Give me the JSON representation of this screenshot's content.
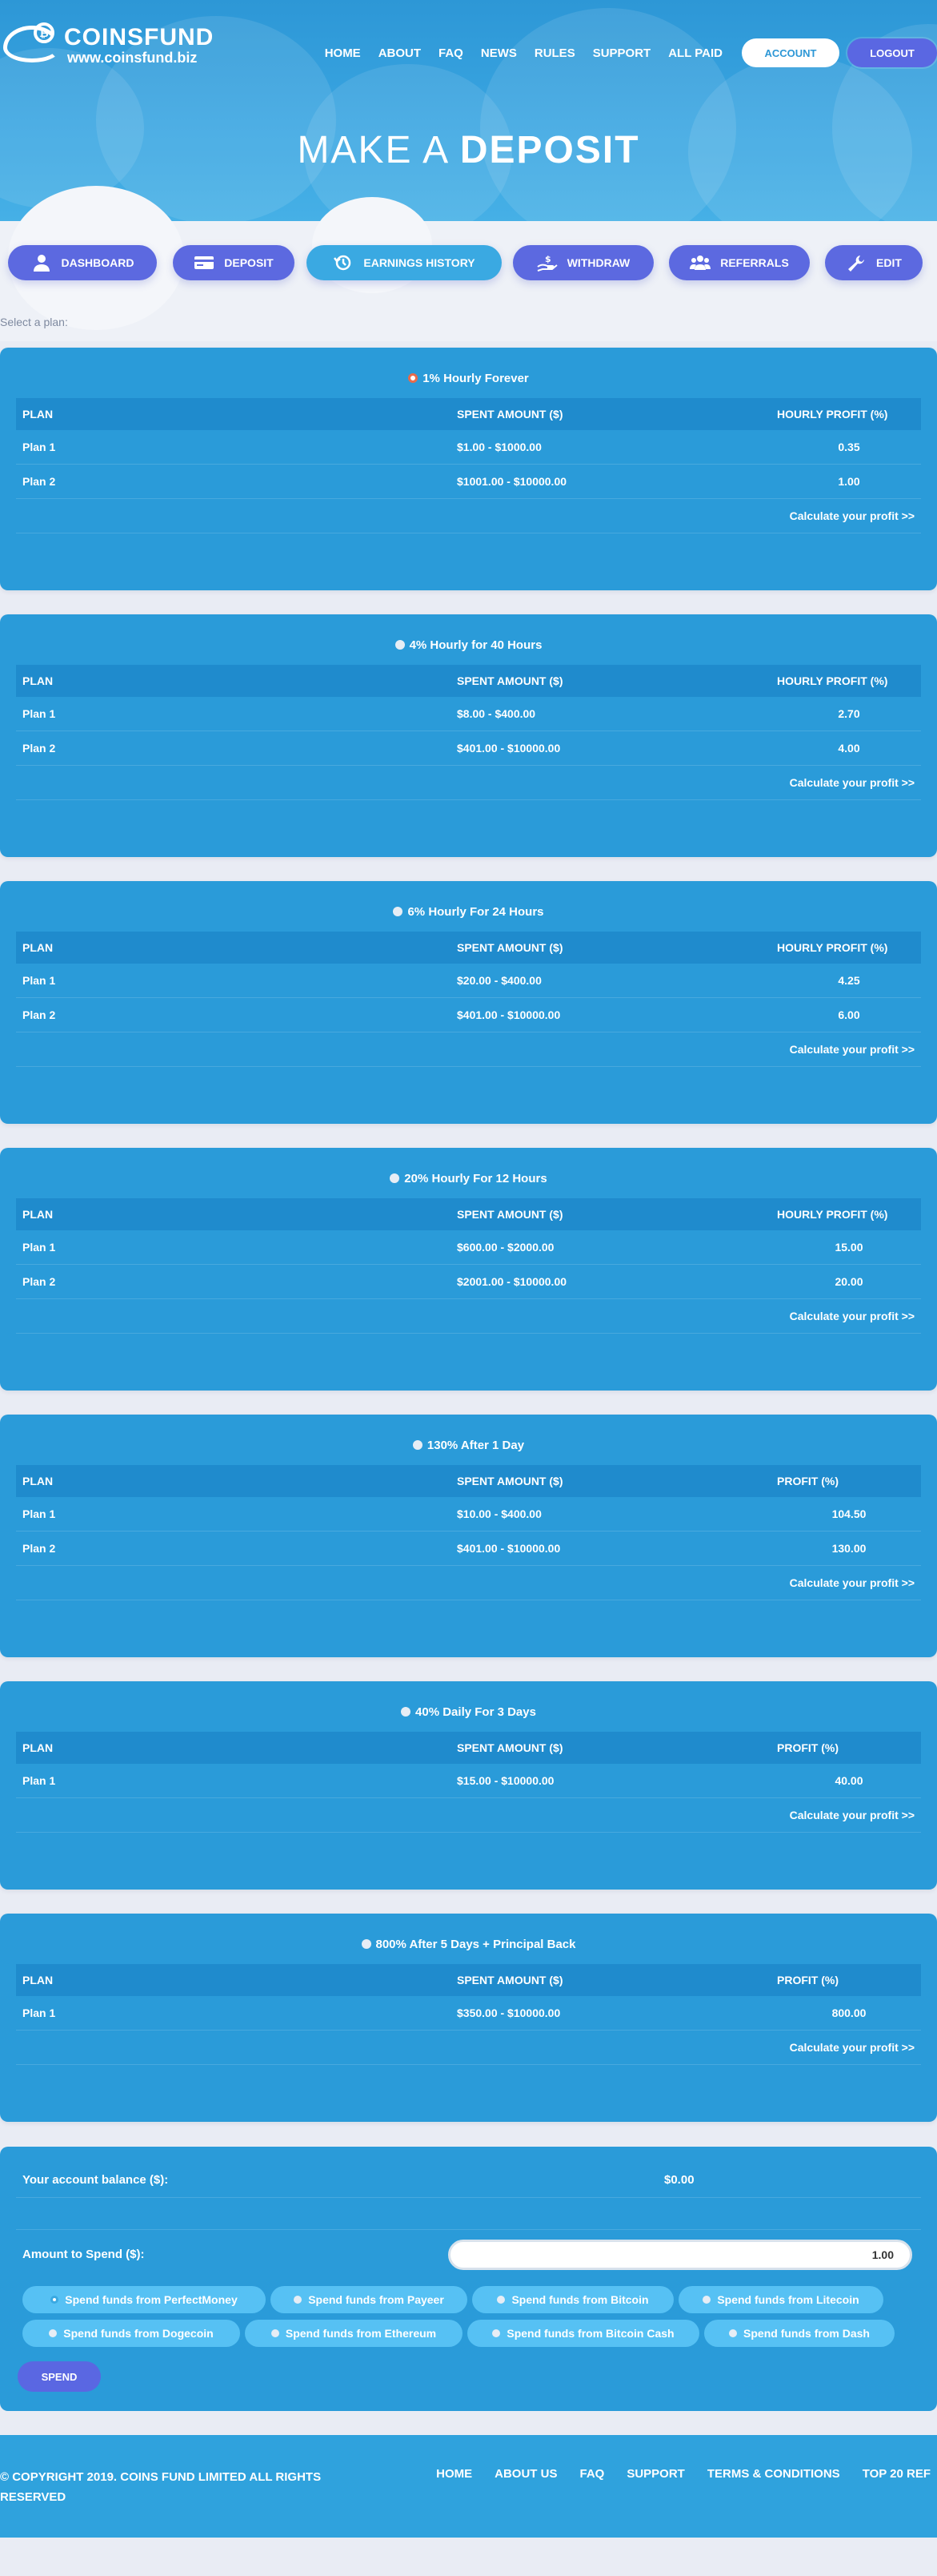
{
  "brand": {
    "name": "COINSFUND",
    "url": "www.coinsfund.biz"
  },
  "nav": {
    "links": [
      "HOME",
      "ABOUT",
      "FAQ",
      "NEWS",
      "RULES",
      "SUPPORT",
      "ALL PAID"
    ],
    "account_label": "ACCOUNT",
    "logout_label": "LOGOUT"
  },
  "hero": {
    "title_light": "MAKE A ",
    "title_bold": "DEPOSIT"
  },
  "actions": [
    {
      "label": "DASHBOARD",
      "icon": "user-icon"
    },
    {
      "label": "DEPOSIT",
      "icon": "credit-card-icon"
    },
    {
      "label": "EARNINGS HISTORY",
      "icon": "history-icon"
    },
    {
      "label": "WITHDRAW",
      "icon": "hand-dollar-icon"
    },
    {
      "label": "REFERRALS",
      "icon": "users-icon"
    },
    {
      "label": "EDIT",
      "icon": "wrench-icon"
    }
  ],
  "select_plan_label": "Select a plan:",
  "calc_label": "Calculate your profit >>",
  "plans": [
    {
      "title": "1% Hourly Forever",
      "selected": true,
      "cols": [
        "PLAN",
        "SPENT AMOUNT ($)",
        "HOURLY PROFIT (%)"
      ],
      "rows": [
        [
          "Plan 1",
          "$1.00 - $1000.00",
          "0.35"
        ],
        [
          "Plan 2",
          "$1001.00 - $10000.00",
          "1.00"
        ]
      ]
    },
    {
      "title": "4% Hourly for 40 Hours",
      "selected": false,
      "cols": [
        "PLAN",
        "SPENT AMOUNT ($)",
        "HOURLY PROFIT (%)"
      ],
      "rows": [
        [
          "Plan 1",
          "$8.00 - $400.00",
          "2.70"
        ],
        [
          "Plan 2",
          "$401.00 - $10000.00",
          "4.00"
        ]
      ]
    },
    {
      "title": "6% Hourly For 24 Hours",
      "selected": false,
      "cols": [
        "PLAN",
        "SPENT AMOUNT ($)",
        "HOURLY PROFIT (%)"
      ],
      "rows": [
        [
          "Plan 1",
          "$20.00 - $400.00",
          "4.25"
        ],
        [
          "Plan 2",
          "$401.00 - $10000.00",
          "6.00"
        ]
      ]
    },
    {
      "title": "20% Hourly For 12 Hours",
      "selected": false,
      "cols": [
        "PLAN",
        "SPENT AMOUNT ($)",
        "HOURLY PROFIT (%)"
      ],
      "rows": [
        [
          "Plan 1",
          "$600.00 - $2000.00",
          "15.00"
        ],
        [
          "Plan 2",
          "$2001.00 - $10000.00",
          "20.00"
        ]
      ]
    },
    {
      "title": "130% After 1 Day",
      "selected": false,
      "cols": [
        "PLAN",
        "SPENT AMOUNT ($)",
        "PROFIT (%)"
      ],
      "rows": [
        [
          "Plan 1",
          "$10.00 - $400.00",
          "104.50"
        ],
        [
          "Plan 2",
          "$401.00 - $10000.00",
          "130.00"
        ]
      ]
    },
    {
      "title": "40% Daily For 3 Days",
      "selected": false,
      "cols": [
        "PLAN",
        "SPENT AMOUNT ($)",
        "PROFIT (%)"
      ],
      "rows": [
        [
          "Plan 1",
          "$15.00 - $10000.00",
          "40.00"
        ]
      ]
    },
    {
      "title": "800% After 5 Days + Principal Back",
      "selected": false,
      "cols": [
        "PLAN",
        "SPENT AMOUNT ($)",
        "PROFIT (%)"
      ],
      "rows": [
        [
          "Plan 1",
          "$350.00 - $10000.00",
          "800.00"
        ]
      ]
    }
  ],
  "balance": {
    "label": "Your account balance ($):",
    "value": "$0.00"
  },
  "amount": {
    "label": "Amount to Spend ($):",
    "value": "1.00"
  },
  "sources": [
    "Spend funds from PerfectMoney",
    "Spend funds from Payeer",
    "Spend funds from Bitcoin",
    "Spend funds from Litecoin",
    "Spend funds from Dogecoin",
    "Spend funds from Ethereum",
    "Spend funds from Bitcoin Cash",
    "Spend funds from Dash"
  ],
  "spend_label": "SPEND",
  "footer": {
    "copyright": "© COPYRIGHT 2019. COINS FUND LIMITED ALL RIGHTS RESERVED",
    "links": [
      "HOME",
      "ABOUT US",
      "FAQ",
      "SUPPORT",
      "TERMS & CONDITIONS",
      "TOP 20 REF"
    ]
  },
  "colors": {
    "primary": "#2a9bd9",
    "accent": "#5a67e2",
    "hero": "#2d97d6",
    "source_button": "#56c1f4"
  }
}
